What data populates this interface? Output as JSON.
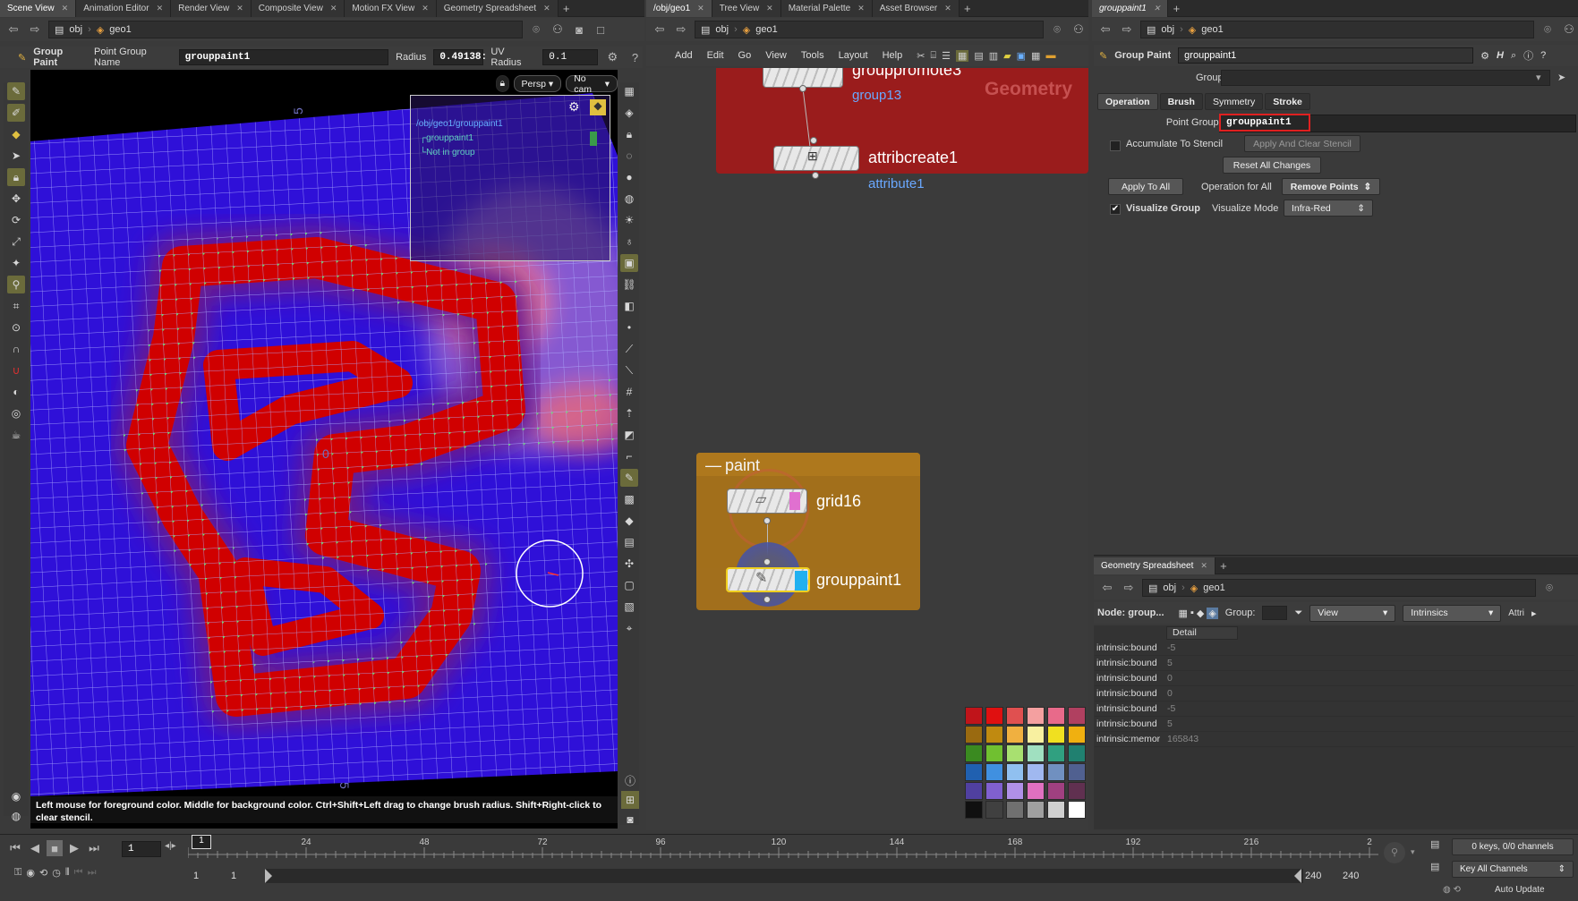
{
  "left_tabs": [
    "Scene View",
    "Animation Editor",
    "Render View",
    "Composite View",
    "Motion FX View",
    "Geometry Spreadsheet"
  ],
  "mid_tabs": [
    "/obj/geo1",
    "Tree View",
    "Material Palette",
    "Asset Browser"
  ],
  "right_tabs": [
    "grouppaint1"
  ],
  "path": {
    "root": "obj",
    "node": "geo1"
  },
  "viewport": {
    "tool_name": "Group Paint",
    "pgn_label": "Point Group Name",
    "pgn_value": "grouppaint1",
    "radius_label": "Radius",
    "radius_value": "0.49138:",
    "uv_radius_label": "UV Radius",
    "uv_radius_value": "0.1",
    "persp": "Persp",
    "cam": "No cam",
    "inset_path": "/obj/geo1/grouppaint1",
    "inset_items": [
      "grouppaint1",
      "Not in group"
    ],
    "hint": "Left mouse for foreground color. Middle for background color. Ctrl+Shift+Left drag to change brush radius. Shift+Right-click to clear stencil.",
    "grid_marks": [
      "5",
      "0",
      "5"
    ]
  },
  "network": {
    "menu": [
      "Add",
      "Edit",
      "Go",
      "View",
      "Tools",
      "Layout",
      "Help"
    ],
    "nodes": {
      "grouppromote": "grouppromote3",
      "group13": "group13",
      "attribcreate": "attribcreate1",
      "attribute1": "attribute1",
      "geometry_label": "Geometry",
      "paint_box": "paint",
      "grid": "grid16",
      "grouppaint": "grouppaint1"
    },
    "swatches": [
      "#c0141a",
      "#e01010",
      "#e05050",
      "#f4a0a0",
      "#e86a8a",
      "#b04060",
      "#9a6a10",
      "#c08a10",
      "#f0b040",
      "#f8f0a0",
      "#f0e020",
      "#f0b010",
      "#3a8a20",
      "#70c030",
      "#a8e070",
      "#a0e0c0",
      "#30a080",
      "#208070",
      "#2060b0",
      "#4090e0",
      "#90c0f0",
      "#a0b8f0",
      "#7090c0",
      "#506090",
      "#5040a0",
      "#8060d0",
      "#b090e8",
      "#e070c0",
      "#a04080",
      "#603050",
      "#101010",
      "#404040",
      "#707070",
      "#a0a0a0",
      "#d0d0d0",
      "#ffffff"
    ]
  },
  "params": {
    "title": "Group Paint",
    "node_name": "grouppaint1",
    "group_label": "Group",
    "tabs": [
      "Operation",
      "Brush",
      "Symmetry",
      "Stroke"
    ],
    "pgn_label": "Point Group Name",
    "pgn_value": "grouppaint1",
    "accumulate": "Accumulate To Stencil",
    "apply_clear": "Apply And Clear Stencil",
    "reset": "Reset All Changes",
    "apply_all": "Apply To All",
    "op_all_label": "Operation for All",
    "op_all_value": "Remove Points",
    "visualize": "Visualize Group",
    "vis_mode_label": "Visualize Mode",
    "vis_mode_value": "Infra-Red",
    "highlight": "#e02020"
  },
  "spreadsheet": {
    "tab": "Geometry Spreadsheet",
    "node_label": "Node: group...",
    "group_label": "Group:",
    "view": "View",
    "intrinsics": "Intrinsics",
    "attr": "Attri",
    "col": "Detail",
    "rows": [
      [
        "intrinsic:bound",
        "-5"
      ],
      [
        "intrinsic:bound",
        "5"
      ],
      [
        "intrinsic:bound",
        "0"
      ],
      [
        "intrinsic:bound",
        "0"
      ],
      [
        "intrinsic:bound",
        "-5"
      ],
      [
        "intrinsic:bound",
        "5"
      ],
      [
        "intrinsic:memor",
        "165843"
      ]
    ]
  },
  "timeline": {
    "frame": "1",
    "marker": "1",
    "ticks": [
      "24",
      "48",
      "72",
      "96",
      "120",
      "144",
      "168",
      "192",
      "216",
      "2"
    ],
    "start": "1",
    "start2": "1",
    "end": "240",
    "end2": "240",
    "keys": "0 keys, 0/0 channels",
    "key_all": "Key All Channels",
    "auto_update": "Auto Update"
  }
}
